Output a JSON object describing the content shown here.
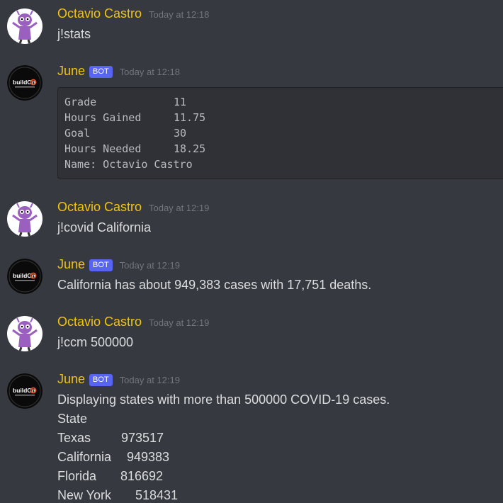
{
  "messages": [
    {
      "author": "Octavio Castro",
      "timestamp": "Today at 12:18",
      "text": "j!stats"
    },
    {
      "author": "June",
      "bot_tag": "BOT",
      "timestamp": "Today at 12:18",
      "stats": [
        {
          "key": "Grade",
          "value": "11"
        },
        {
          "key": "Hours Gained",
          "value": "11.75"
        },
        {
          "key": "Goal",
          "value": "30"
        },
        {
          "key": "Hours Needed",
          "value": "18.25"
        },
        {
          "key": "Name: Octavio Castro",
          "value": ""
        }
      ]
    },
    {
      "author": "Octavio Castro",
      "timestamp": "Today at 12:19",
      "text": "j!covid California"
    },
    {
      "author": "June",
      "bot_tag": "BOT",
      "timestamp": "Today at 12:19",
      "text": "California has about 949,383 cases with 17,751 deaths."
    },
    {
      "author": "Octavio Castro",
      "timestamp": "Today at 12:19",
      "text": "j!ccm 500000"
    },
    {
      "author": "June",
      "bot_tag": "BOT",
      "timestamp": "Today at 12:19",
      "text": "Displaying states with more than 500000 COVID-19 cases.",
      "table_header": "State",
      "states": [
        {
          "name": "Texas",
          "cases": "973517"
        },
        {
          "name": "California",
          "cases": "949383"
        },
        {
          "name": "Florida",
          "cases": "816692"
        },
        {
          "name": "New York",
          "cases": "518431"
        }
      ]
    }
  ],
  "bot_avatar_text": "buildOn",
  "colors": {
    "background": "#36393f",
    "username": "#f1c40f",
    "bot_tag": "#5865f2",
    "timestamp": "#72767d",
    "text": "#dcddde",
    "codeblock_bg": "#2f3136"
  }
}
